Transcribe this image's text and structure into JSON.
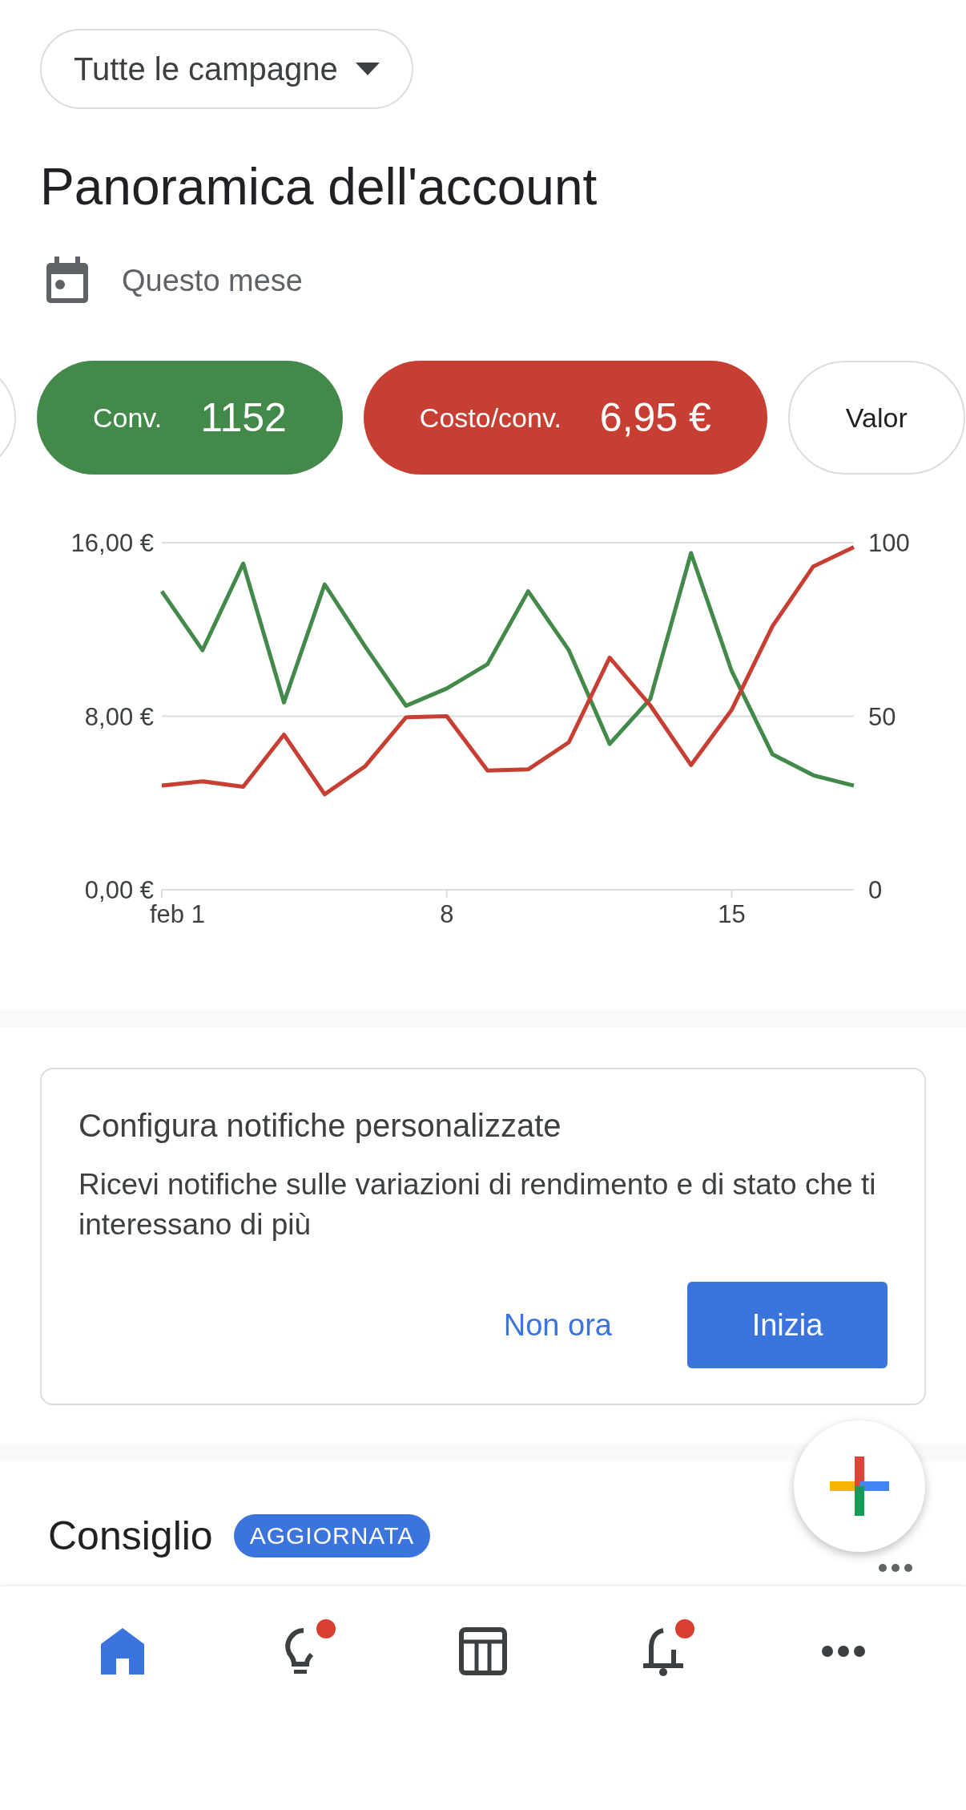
{
  "campaign_filter": {
    "label": "Tutte le campagne"
  },
  "title": "Panoramica dell'account",
  "date_range": {
    "label": "Questo mese"
  },
  "metric_chips": [
    {
      "selected": false
    },
    {
      "label": "Conv.",
      "value": "1152",
      "selected": true,
      "color": "#43894a"
    },
    {
      "label": "Costo/conv.",
      "value": "6,95 €",
      "selected": true,
      "color": "#c63f32"
    },
    {
      "label": "Valor",
      "selected": false
    }
  ],
  "chart": {
    "chart_data": {
      "type": "line",
      "x": [
        1,
        2,
        3,
        4,
        5,
        6,
        7,
        8,
        9,
        10,
        11,
        12,
        13,
        14,
        15,
        16,
        17,
        18
      ],
      "xlim": [
        1,
        18
      ],
      "xticks": [
        {
          "value": 1,
          "label": "feb 1"
        },
        {
          "value": 8,
          "label": "8"
        },
        {
          "value": 15,
          "label": "15"
        }
      ],
      "ylim": [
        0,
        16
      ],
      "yticks": [
        {
          "value": 0,
          "label": "0,00 €"
        },
        {
          "value": 8,
          "label": "8,00 €"
        },
        {
          "value": 16,
          "label": "16,00 €"
        }
      ],
      "y2lim": [
        0,
        100
      ],
      "y2ticks": [
        0,
        50,
        100
      ],
      "series": [
        {
          "color": "#43894a",
          "axis": "y2",
          "values": [
            86,
            69,
            94,
            54,
            88,
            70,
            53,
            58,
            65,
            86,
            69,
            42,
            55,
            97,
            63,
            39,
            33,
            30
          ]
        },
        {
          "color": "#c63f32",
          "values": [
            4.8,
            5.0,
            4.75,
            7.15,
            4.4,
            5.7,
            7.95,
            8.0,
            5.5,
            5.55,
            6.8,
            10.7,
            8.5,
            5.75,
            8.3,
            12.15,
            14.9,
            15.8
          ]
        }
      ]
    }
  },
  "notification_card": {
    "title": "Configura notifiche personalizzate",
    "text": "Ricevi notifiche sulle variazioni di rendimento e di stato che ti interessano di più",
    "buttons": [
      {
        "label": "Non ora",
        "kind": "text"
      },
      {
        "label": "Inizia",
        "kind": "filled"
      }
    ]
  },
  "recommendation": {
    "title": "Consiglio",
    "badge": "AGGIORNATA"
  },
  "bottom_nav": [
    {
      "kind": "home",
      "selected": true,
      "dot": false
    },
    {
      "kind": "idea",
      "selected": false,
      "dot": true
    },
    {
      "kind": "table",
      "selected": false,
      "dot": false
    },
    {
      "kind": "bell",
      "selected": false,
      "dot": true
    },
    {
      "kind": "more",
      "selected": false,
      "dot": false
    }
  ]
}
